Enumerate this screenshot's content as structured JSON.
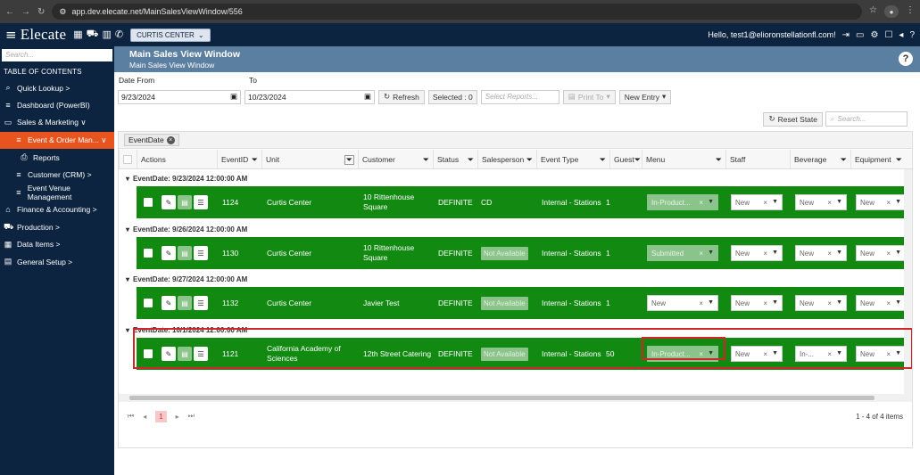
{
  "browser": {
    "url": "app.dev.elecate.net/MainSalesViewWindow/556"
  },
  "header": {
    "logo": "Elecate",
    "location": "CURTIS CENTER",
    "greeting": "Hello, test1@elioronstellationfl.com!"
  },
  "sidebar": {
    "search_placeholder": "Search...",
    "toc_title": "TABLE OF CONTENTS",
    "items": [
      {
        "label": "Quick Lookup  >",
        "icon": "search-icon"
      },
      {
        "label": "Dashboard (PowerBI)",
        "icon": "list-icon"
      },
      {
        "label": "Sales & Marketing  ∨",
        "icon": "monitor-icon"
      },
      {
        "label": "Event & Order Man...  ∨",
        "icon": "list-icon",
        "active": true
      },
      {
        "label": "Reports",
        "icon": "print-icon"
      },
      {
        "label": "Customer (CRM)  >",
        "icon": "list-icon"
      },
      {
        "label": "Event Venue Management",
        "icon": "list-icon"
      },
      {
        "label": "Finance & Accounting  >",
        "icon": "bank-icon"
      },
      {
        "label": "Production  >",
        "icon": "truck-icon"
      },
      {
        "label": "Data Items  >",
        "icon": "grid-icon"
      },
      {
        "label": "General Setup  >",
        "icon": "printer-icon"
      }
    ]
  },
  "window": {
    "title": "Main Sales View Window",
    "subtitle": "Main Sales View Window"
  },
  "toolbar": {
    "date_from_label": "Date From",
    "to_label": "To",
    "date_from": "9/23/2024",
    "date_to": "10/23/2024",
    "refresh": "Refresh",
    "selected": "Selected : 0",
    "select_reports_placeholder": "Select Reports...",
    "print_to": "Print To",
    "new_entry": "New Entry",
    "reset_state": "Reset State",
    "search_placeholder": "Search..."
  },
  "grid": {
    "group_chip": "EventDate",
    "columns": [
      "Actions",
      "EventID",
      "Unit",
      "Customer",
      "Status",
      "Salesperson",
      "Event Type",
      "Guest",
      "Menu",
      "Staff",
      "Beverage",
      "Equipment"
    ],
    "groups": [
      {
        "header": "EventDate: 9/23/2024 12:00:00 AM",
        "row": {
          "event_id": "1124",
          "unit": "Curtis Center",
          "customer": "10 Rittenhouse Square",
          "status": "DEFINITE",
          "salesperson": "CD",
          "sp_na": false,
          "event_type": "Internal - Stations",
          "guest": "1",
          "menu": "In-Product...",
          "menu_dim": true,
          "staff": "New",
          "beverage": "New",
          "equipment": "New"
        }
      },
      {
        "header": "EventDate: 9/26/2024 12:00:00 AM",
        "row": {
          "event_id": "1130",
          "unit": "Curtis Center",
          "customer": "10 Rittenhouse Square",
          "status": "DEFINITE",
          "salesperson": "Not Available",
          "sp_na": true,
          "event_type": "Internal - Stations",
          "guest": "1",
          "menu": "Submitted",
          "menu_dim": true,
          "staff": "New",
          "beverage": "New",
          "equipment": "New"
        }
      },
      {
        "header": "EventDate: 9/27/2024 12:00:00 AM",
        "row": {
          "event_id": "1132",
          "unit": "Curtis Center",
          "customer": "Javier Test",
          "status": "DEFINITE",
          "salesperson": "Not Available",
          "sp_na": true,
          "event_type": "Internal - Stations",
          "guest": "1",
          "menu": "New",
          "menu_dim": false,
          "staff": "New",
          "beverage": "New",
          "equipment": "New"
        }
      },
      {
        "header": "EventDate: 10/1/2024 12:00:00 AM",
        "row": {
          "event_id": "1121",
          "unit": "California Academy of Sciences",
          "customer": "12th Street Catering",
          "status": "DEFINITE",
          "salesperson": "Not Available",
          "sp_na": true,
          "event_type": "Internal - Stations",
          "guest": "50",
          "menu": "In-Product...",
          "menu_dim": true,
          "staff": "New",
          "beverage": "In-...",
          "equipment": "New"
        }
      }
    ],
    "pager": {
      "page": "1",
      "info": "1 - 4 of 4 items"
    }
  }
}
